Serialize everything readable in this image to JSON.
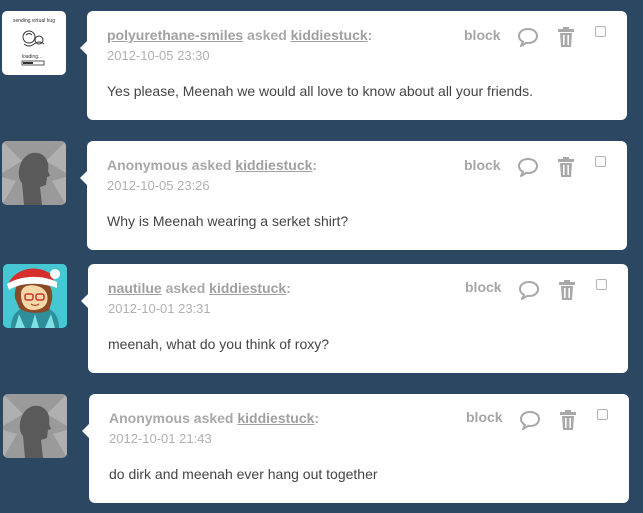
{
  "posts": [
    {
      "asker": "polyurethane-smiles",
      "asked_word": "asked",
      "blog": "kiddiestuck",
      "colon": ":",
      "date": "2012-10-05 23:30",
      "message": "Yes please, Meenah we would all love to know about all your friends.",
      "block_label": "block",
      "avatar": {
        "type": "hug-drawing",
        "line1": "sending virtual hug",
        "line2": "loading..."
      }
    },
    {
      "asker": "Anonymous",
      "asked_word": "asked",
      "blog": "kiddiestuck",
      "colon": ":",
      "date": "2012-10-05 23:26",
      "message": "Why is Meenah wearing a serket shirt?",
      "block_label": "block",
      "avatar": {
        "type": "anonymous-silhouette"
      }
    },
    {
      "asker": "nautilue",
      "asked_word": "asked",
      "blog": "kiddiestuck",
      "colon": ":",
      "date": "2012-10-01 23:31",
      "message": "meenah, what do you think of roxy?",
      "block_label": "block",
      "avatar": {
        "type": "santa-hat-character"
      }
    },
    {
      "asker": "Anonymous",
      "asked_word": "asked",
      "blog": "kiddiestuck",
      "colon": ":",
      "date": "2012-10-01 21:43",
      "message": "do dirk and meenah ever hang out together",
      "block_label": "block",
      "avatar": {
        "type": "anonymous-silhouette"
      }
    }
  ],
  "colors": {
    "background": "#2c4762",
    "card": "#ffffff",
    "meta_text": "#a8a8a8",
    "body_text": "#444444"
  }
}
